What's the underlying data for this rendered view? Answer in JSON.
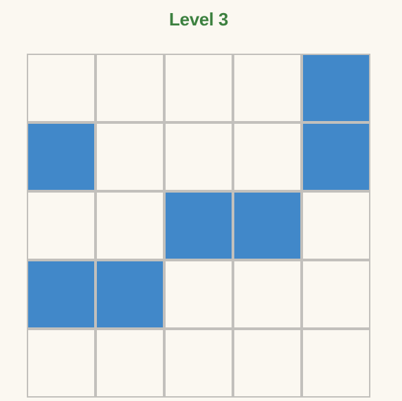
{
  "level_title": "Level 3",
  "colors": {
    "background": "#fbf8f1",
    "title": "#3d8140",
    "filled": "#4188c9",
    "empty": "#fbf8f1",
    "grid_line": "#c2c0bc"
  },
  "grid": {
    "rows": 5,
    "cols": 5,
    "cells": [
      [
        0,
        0,
        0,
        0,
        1
      ],
      [
        1,
        0,
        0,
        0,
        1
      ],
      [
        0,
        0,
        1,
        1,
        0
      ],
      [
        1,
        1,
        0,
        0,
        0
      ],
      [
        0,
        0,
        0,
        0,
        0
      ]
    ]
  }
}
